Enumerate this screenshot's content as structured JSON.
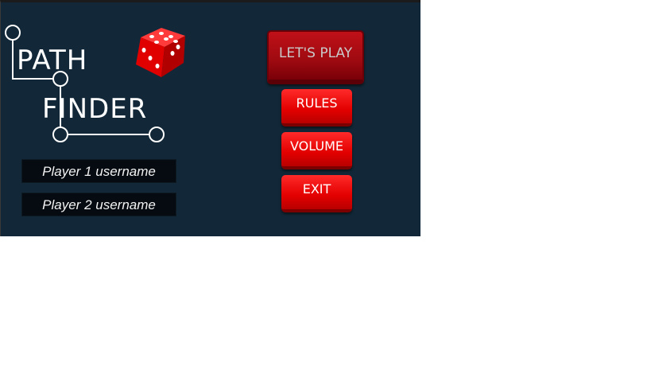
{
  "logo": {
    "line1": "PATH",
    "line2": "FINDER"
  },
  "icons": {
    "dice": "dice-icon"
  },
  "inputs": {
    "player1": "Player 1 username",
    "player2": "Player 2 username"
  },
  "menu": {
    "play_label": "LET'S PLAY",
    "rules_label": "RULES",
    "volume_label": "VOLUME",
    "exit_label": "EXIT"
  },
  "colors": {
    "background": "#122838",
    "button_red": "#e30000",
    "play_button": "#9e0a10",
    "logo_white": "#ffffff"
  }
}
